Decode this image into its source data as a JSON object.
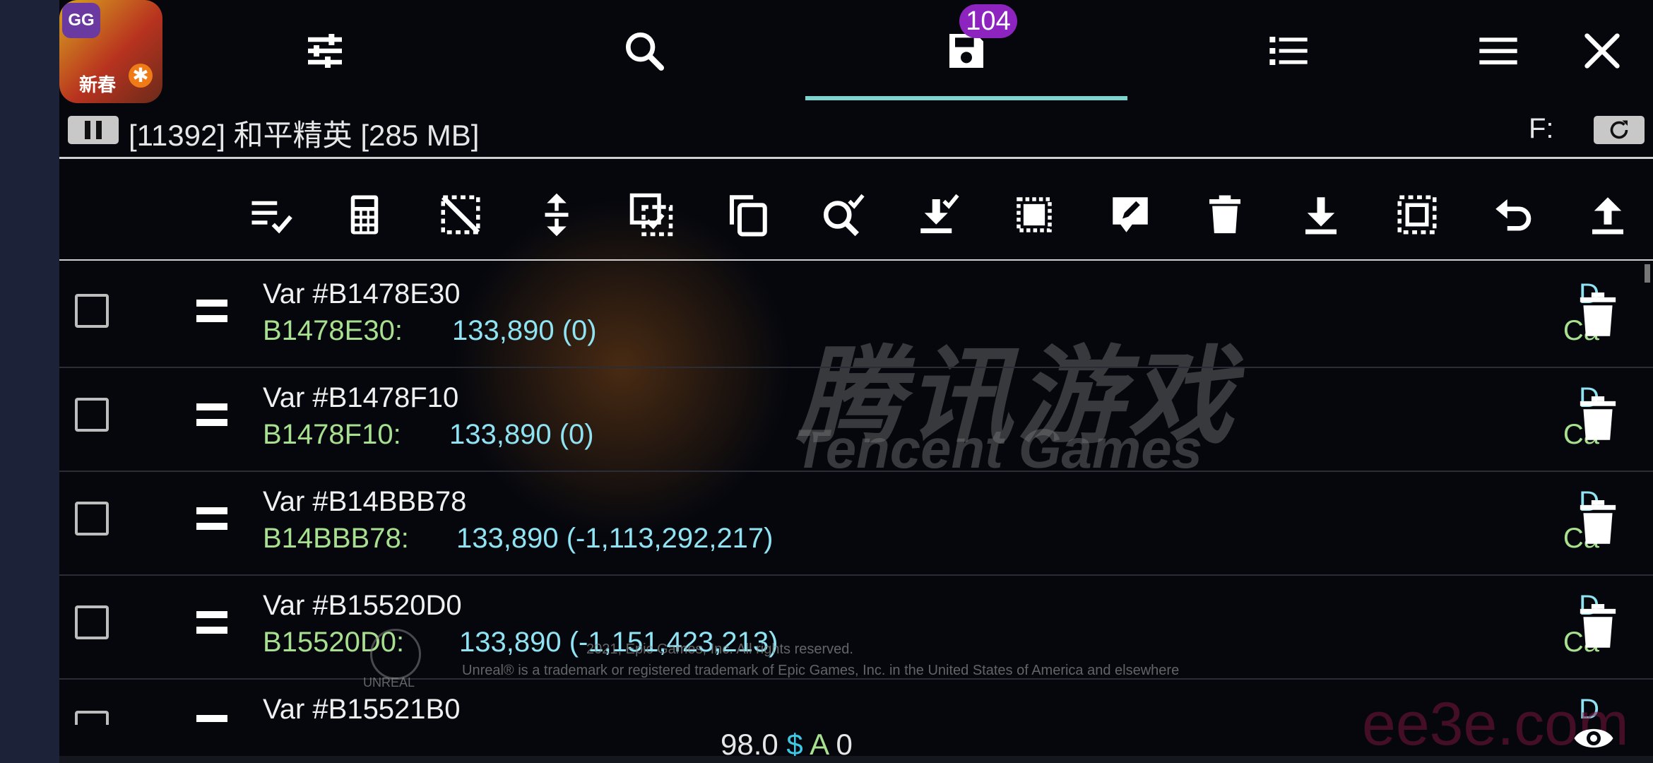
{
  "colors": {
    "accent": "#7fd3cf",
    "badge": "#8e24c0",
    "address": "#a7e08e",
    "value": "#8fe3f2"
  },
  "app_icon": {
    "gg_label": "GG",
    "cn_label": "新春"
  },
  "tabs": [
    {
      "name": "settings-tab",
      "icon": "sliders-icon"
    },
    {
      "name": "search-tab",
      "icon": "search-icon"
    },
    {
      "name": "saved-list-tab",
      "icon": "save-icon",
      "badge": "104",
      "active": true
    },
    {
      "name": "list-tab",
      "icon": "list-icon"
    },
    {
      "name": "menu-tab",
      "icon": "menu-icon"
    },
    {
      "name": "close-tab",
      "icon": "close-icon"
    }
  ],
  "process": {
    "label": "[11392] 和平精英 [285 MB]",
    "f_label": "F:"
  },
  "toolbar": [
    "select-all-icon",
    "calculator-icon",
    "invert-selection-icon",
    "move-icon",
    "copy-selected-icon",
    "copy-icon",
    "search-check-icon",
    "load-check-icon",
    "chip-icon",
    "edit-icon",
    "delete-icon",
    "download-icon",
    "select-box-icon",
    "undo-icon",
    "upload-icon"
  ],
  "rows": [
    {
      "name": "Var #B1478E30",
      "addr": "B1478E30:",
      "value": "133,890 (0)",
      "d": "D",
      "ca": "Ca"
    },
    {
      "name": "Var #B1478F10",
      "addr": "B1478F10:",
      "value": "133,890 (0)",
      "d": "D",
      "ca": "Ca"
    },
    {
      "name": "Var #B14BBB78",
      "addr": "B14BBB78:",
      "value": "133,890 (-1,113,292,217)",
      "d": "D",
      "ca": "Ca"
    },
    {
      "name": "Var #B15520D0",
      "addr": "B15520D0:",
      "value": "133,890 (-1,151,423,213)",
      "d": "D",
      "ca": "Ca"
    },
    {
      "name": "Var #B15521B0",
      "addr": "",
      "value": "",
      "d": "D",
      "ca": ""
    }
  ],
  "watermark": {
    "cn": "腾讯游戏",
    "en": "Tencent Games"
  },
  "copyright": {
    "line1": "2021, Epic Games, Inc.  All rights reserved.",
    "line2": "Unreal® is a trademark or registered trademark of Epic Games, Inc. in the United States of America and elsewhere",
    "unreal": "UNREAL"
  },
  "footer": {
    "value": "98.0",
    "dollar": "$",
    "a": "A",
    "count": "0"
  },
  "site_watermark": "ee3e.com"
}
